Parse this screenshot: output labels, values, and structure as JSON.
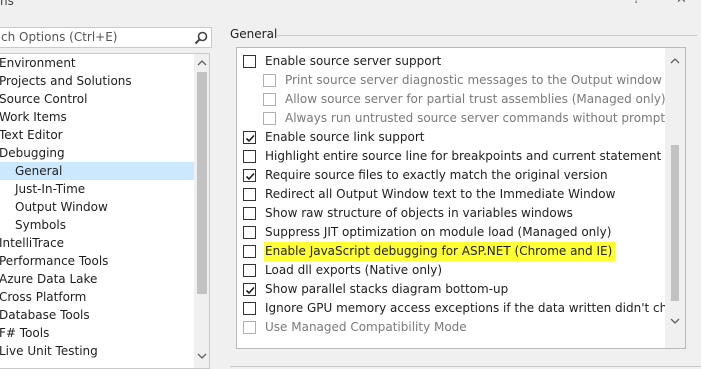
{
  "window": {
    "title_fragment": "ns",
    "help_button": "?",
    "close_button": "✕"
  },
  "search": {
    "placeholder": "ch Options (Ctrl+E)",
    "icon": "search-icon"
  },
  "tree": {
    "items": [
      {
        "label": "Environment"
      },
      {
        "label": "Projects and Solutions"
      },
      {
        "label": "Source Control"
      },
      {
        "label": "Work Items"
      },
      {
        "label": "Text Editor"
      },
      {
        "label": "Debugging"
      },
      {
        "label": "General"
      },
      {
        "label": "Just-In-Time"
      },
      {
        "label": "Output Window"
      },
      {
        "label": "Symbols"
      },
      {
        "label": "IntelliTrace"
      },
      {
        "label": "Performance Tools"
      },
      {
        "label": "Azure Data Lake"
      },
      {
        "label": "Cross Platform"
      },
      {
        "label": "Database Tools"
      },
      {
        "label": "F# Tools"
      },
      {
        "label": "Live Unit Testing"
      }
    ],
    "selected": "General"
  },
  "section": {
    "title": "General"
  },
  "options": [
    {
      "label": "Enable source server support",
      "checked": false,
      "indent": false,
      "disabled": false,
      "highlight": false
    },
    {
      "label": "Print source server diagnostic messages to the Output window",
      "checked": false,
      "indent": true,
      "disabled": true,
      "highlight": false
    },
    {
      "label": "Allow source server for partial trust assemblies (Managed only)",
      "checked": false,
      "indent": true,
      "disabled": true,
      "highlight": false
    },
    {
      "label": "Always run untrusted source server commands without prompting",
      "checked": false,
      "indent": true,
      "disabled": true,
      "highlight": false
    },
    {
      "label": "Enable source link support",
      "checked": true,
      "indent": false,
      "disabled": false,
      "highlight": false
    },
    {
      "label": "Highlight entire source line for breakpoints and current statement (C++ only)",
      "checked": false,
      "indent": false,
      "disabled": false,
      "highlight": false
    },
    {
      "label": "Require source files to exactly match the original version",
      "checked": true,
      "indent": false,
      "disabled": false,
      "highlight": false
    },
    {
      "label": "Redirect all Output Window text to the Immediate Window",
      "checked": false,
      "indent": false,
      "disabled": false,
      "highlight": false
    },
    {
      "label": "Show raw structure of objects in variables windows",
      "checked": false,
      "indent": false,
      "disabled": false,
      "highlight": false
    },
    {
      "label": "Suppress JIT optimization on module load (Managed only)",
      "checked": false,
      "indent": false,
      "disabled": false,
      "highlight": false
    },
    {
      "label": "Enable JavaScript debugging for ASP.NET (Chrome and IE)",
      "checked": false,
      "indent": false,
      "disabled": false,
      "highlight": true
    },
    {
      "label": "Load dll exports (Native only)",
      "checked": false,
      "indent": false,
      "disabled": false,
      "highlight": false
    },
    {
      "label": "Show parallel stacks diagram bottom-up",
      "checked": true,
      "indent": false,
      "disabled": false,
      "highlight": false
    },
    {
      "label": "Ignore GPU memory access exceptions if the data written didn't change the value",
      "checked": false,
      "indent": false,
      "disabled": false,
      "highlight": false
    },
    {
      "label": "Use Managed Compatibility Mode",
      "checked": false,
      "indent": false,
      "disabled": true,
      "highlight": false
    }
  ],
  "colors": {
    "highlight": "#ffff33",
    "selection": "#cfe3f5",
    "scroll_thumb": "#c2c2c2"
  }
}
